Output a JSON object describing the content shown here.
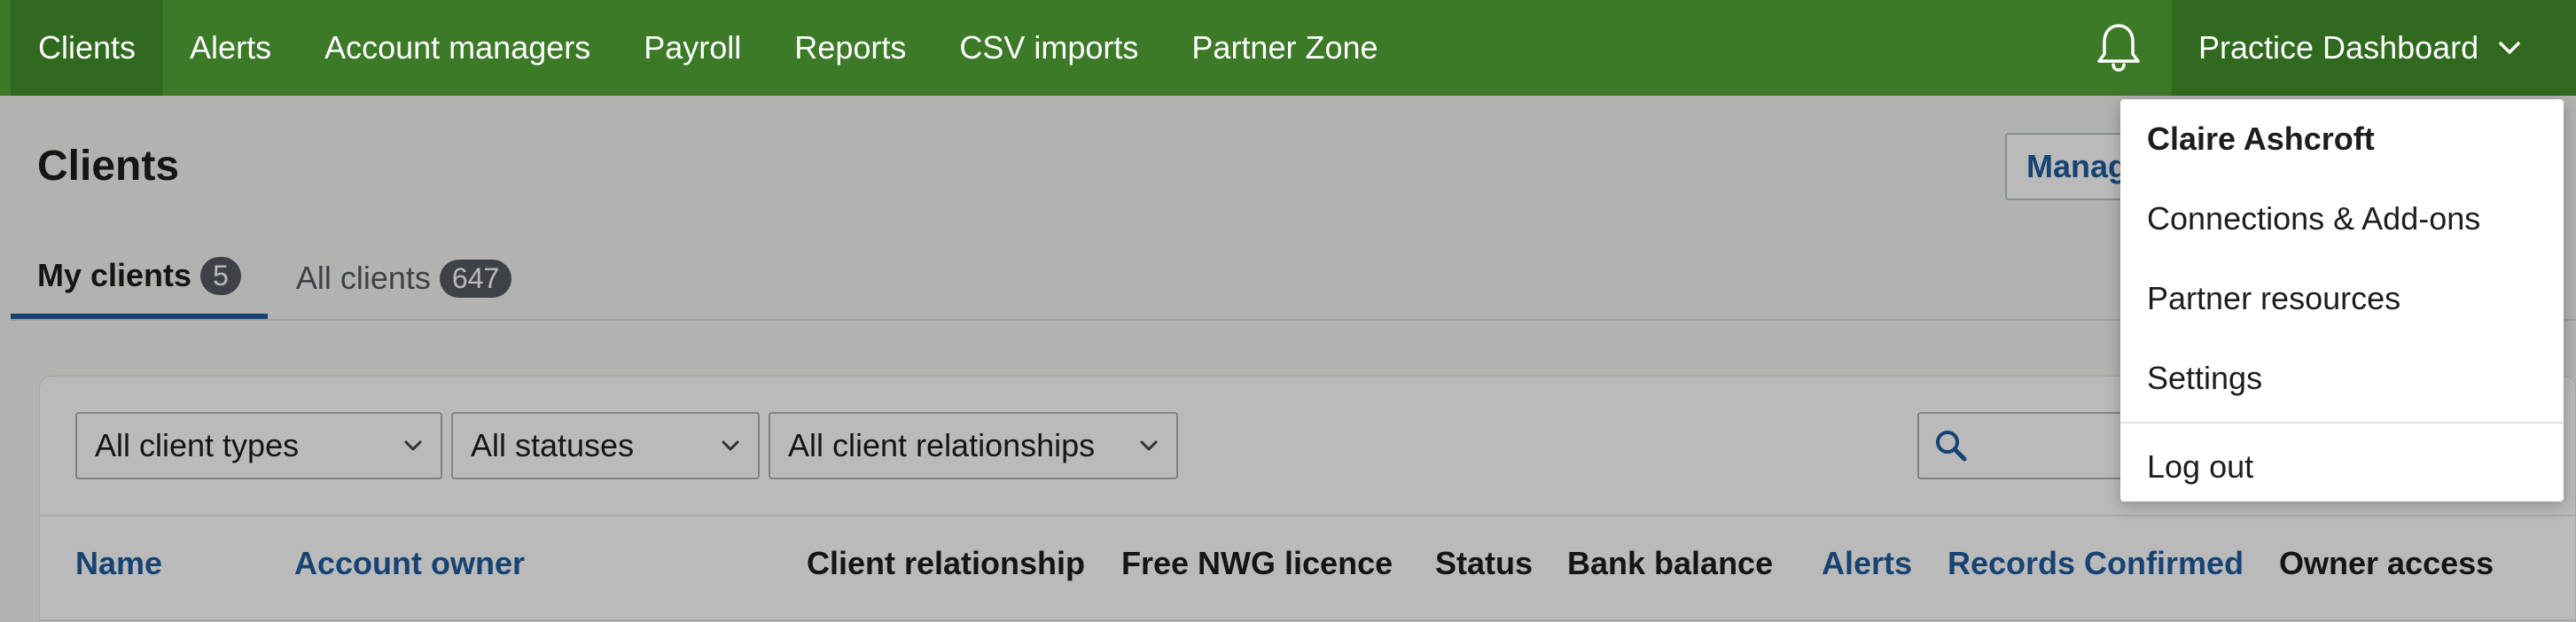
{
  "nav": {
    "items": [
      {
        "label": "Clients"
      },
      {
        "label": "Alerts"
      },
      {
        "label": "Account managers"
      },
      {
        "label": "Payroll"
      },
      {
        "label": "Reports"
      },
      {
        "label": "CSV imports"
      },
      {
        "label": "Partner Zone"
      }
    ],
    "practice_label": "Practice Dashboard"
  },
  "page": {
    "title": "Clients",
    "manage_button": "Manage"
  },
  "tabs": [
    {
      "label": "My clients",
      "count": "5"
    },
    {
      "label": "All clients",
      "count": "647"
    }
  ],
  "filters": [
    {
      "value": "All client types"
    },
    {
      "value": "All statuses"
    },
    {
      "value": "All client relationships"
    }
  ],
  "search": {
    "placeholder": ""
  },
  "table": {
    "headers": [
      "Name",
      "Account owner",
      "Client relationship",
      "Free NWG licence",
      "Status",
      "Bank balance",
      "Alerts",
      "Records Confirmed",
      "Owner access"
    ]
  },
  "dropdown": {
    "user_name": "Claire Ashcroft",
    "items": [
      {
        "label": "Connections & Add-ons"
      },
      {
        "label": "Partner resources"
      },
      {
        "label": "Settings"
      },
      {
        "label": "Log out"
      }
    ]
  },
  "colors": {
    "nav_bg": "#3c7a28",
    "nav_active_bg": "#2f6a1f",
    "link_blue": "#1f5d9e",
    "badge_bg": "#555b60"
  },
  "icons": {
    "bell": "bell-icon",
    "chevron": "chevron-down-icon",
    "search": "search-icon"
  }
}
